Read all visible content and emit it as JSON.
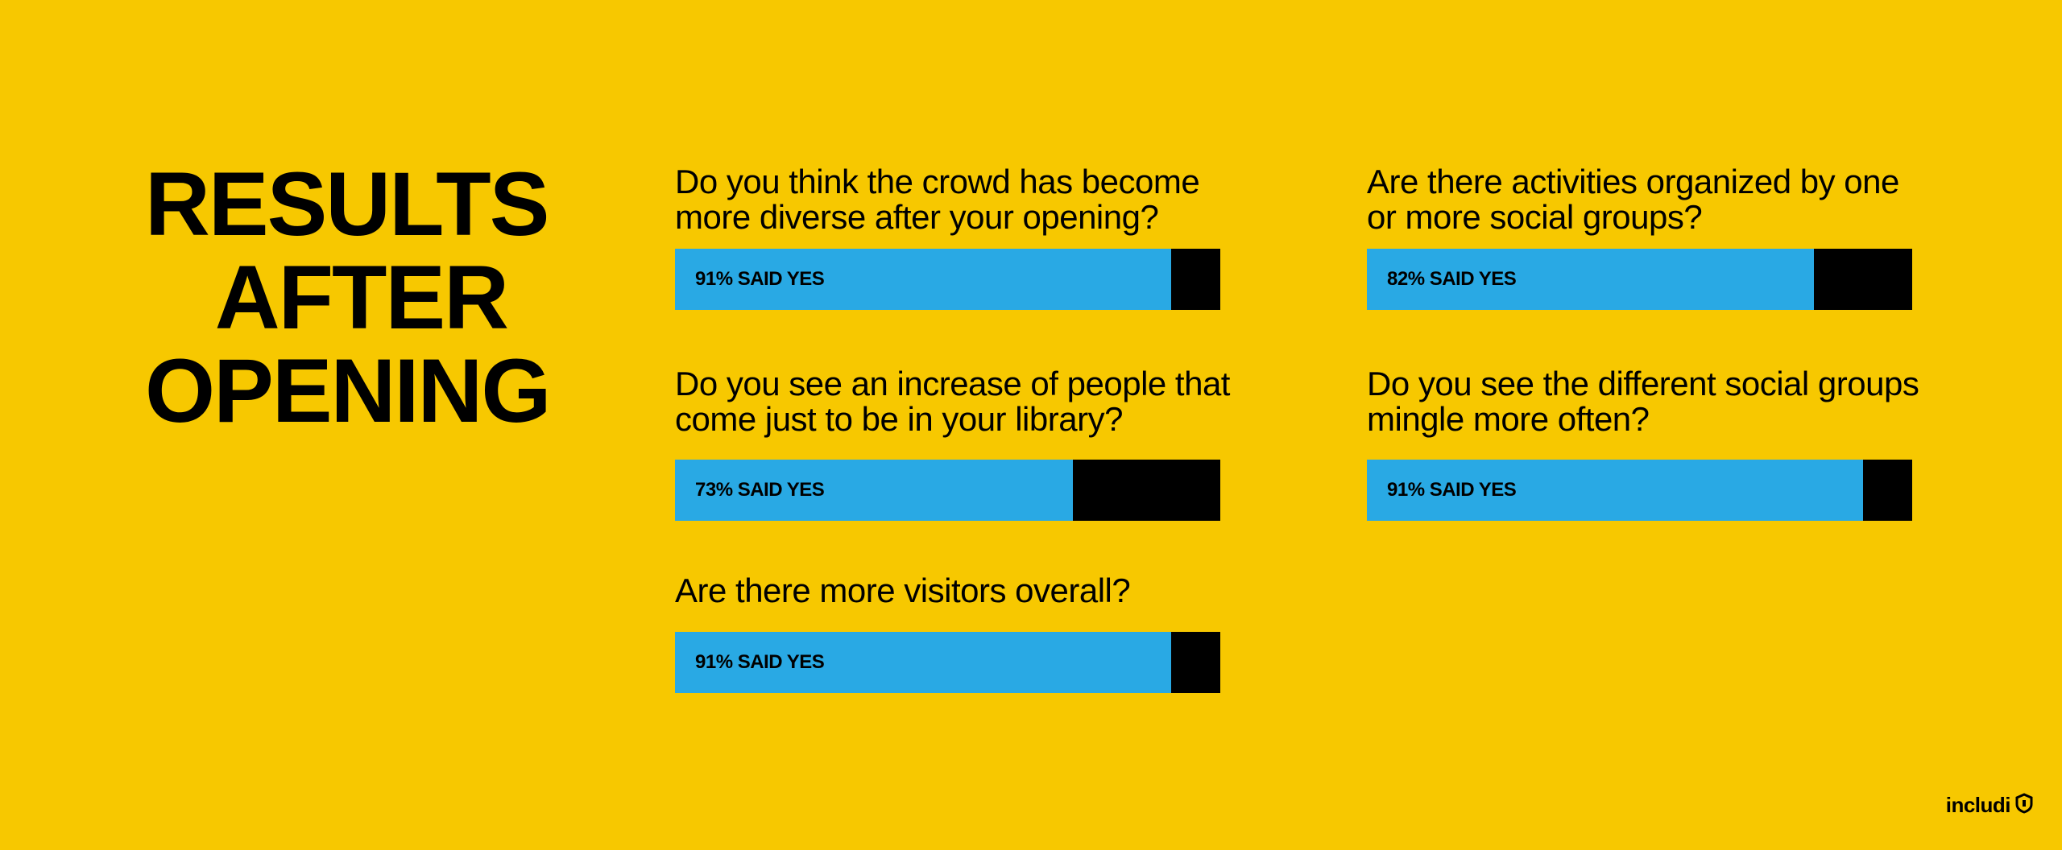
{
  "title": {
    "line1": "RESULTS",
    "line2": "AFTER",
    "line3": "OPENING"
  },
  "chart_data": {
    "type": "bar",
    "title": "RESULTS AFTER OPENING",
    "questions": [
      {
        "question": "Do you think the crowd has become more diverse after your opening?",
        "line1": "Do you think the crowd has become",
        "line2": "more diverse after your opening?",
        "value": 91,
        "label": "91% SAID YES"
      },
      {
        "question": "Do you see an increase of people that come just to be in your library?",
        "line1": "Do you see an increase of people that",
        "line2": "come just to be in your library?",
        "value": 73,
        "label": "73% SAID YES"
      },
      {
        "question": "Are there more visitors overall?",
        "line1": "Are there more visitors overall?",
        "line2": "",
        "value": 91,
        "label": "91% SAID YES"
      },
      {
        "question": "Are there activities organized by one or more social groups?",
        "line1": "Are there activities organized by one",
        "line2": "or more social groups?",
        "value": 82,
        "label": "82% SAID YES"
      },
      {
        "question": "Do you see the different social groups mingle more often?",
        "line1": "Do you see the different social groups",
        "line2": "mingle more often?",
        "value": 91,
        "label": "91% SAID YES"
      }
    ],
    "ylim": [
      0,
      100
    ]
  },
  "colors": {
    "background": "#F7C800",
    "yes": "#29A9E4",
    "rest": "#000000"
  },
  "logo": {
    "text": "includi",
    "icon": "includi-shield-icon"
  }
}
